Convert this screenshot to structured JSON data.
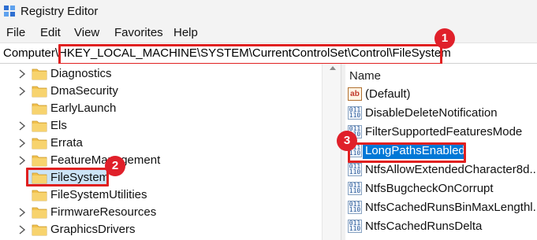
{
  "window": {
    "title": "Registry Editor"
  },
  "menu": [
    "File",
    "Edit",
    "View",
    "Favorites",
    "Help"
  ],
  "address": {
    "prefix": "Computer",
    "path": "\\HKEY_LOCAL_MACHINE\\SYSTEM\\CurrentControlSet\\Control\\FileSystem"
  },
  "tree": {
    "items": [
      {
        "label": "Diagnostics",
        "expandable": true
      },
      {
        "label": "DmaSecurity",
        "expandable": true
      },
      {
        "label": "EarlyLaunch",
        "expandable": false
      },
      {
        "label": "Els",
        "expandable": true
      },
      {
        "label": "Errata",
        "expandable": true
      },
      {
        "label": "FeatureManagement",
        "expandable": true
      },
      {
        "label": "FileSystem",
        "expandable": false,
        "selected": true
      },
      {
        "label": "FileSystemUtilities",
        "expandable": false
      },
      {
        "label": "FirmwareResources",
        "expandable": true
      },
      {
        "label": "GraphicsDrivers",
        "expandable": true
      }
    ]
  },
  "values": {
    "column_name": "Name",
    "items": [
      {
        "name": "(Default)",
        "type": "string",
        "icon_text": "ab"
      },
      {
        "name": "DisableDeleteNotification",
        "type": "dword",
        "icon_text": "011\n110"
      },
      {
        "name": "FilterSupportedFeaturesMode",
        "type": "dword",
        "icon_text": "011\n110"
      },
      {
        "name": "LongPathsEnabled",
        "type": "dword",
        "icon_text": "011\n110",
        "selected": true
      },
      {
        "name": "NtfsAllowExtendedCharacter8d...",
        "type": "dword",
        "icon_text": "011\n110"
      },
      {
        "name": "NtfsBugcheckOnCorrupt",
        "type": "dword",
        "icon_text": "011\n110"
      },
      {
        "name": "NtfsCachedRunsBinMaxLengthl...",
        "type": "dword",
        "icon_text": "011\n110"
      },
      {
        "name": "NtfsCachedRunsDelta",
        "type": "dword",
        "icon_text": "011\n110"
      }
    ]
  },
  "annotations": [
    {
      "number": "1",
      "target": "address bar path"
    },
    {
      "number": "2",
      "target": "FileSystem key"
    },
    {
      "number": "3",
      "target": "LongPathsEnabled value"
    }
  ],
  "colors": {
    "annotation_red": "#e0202a",
    "selection_blue": "#0078d7",
    "tree_selection": "#cce4f7",
    "folder_yellow": "#f2c14e"
  }
}
